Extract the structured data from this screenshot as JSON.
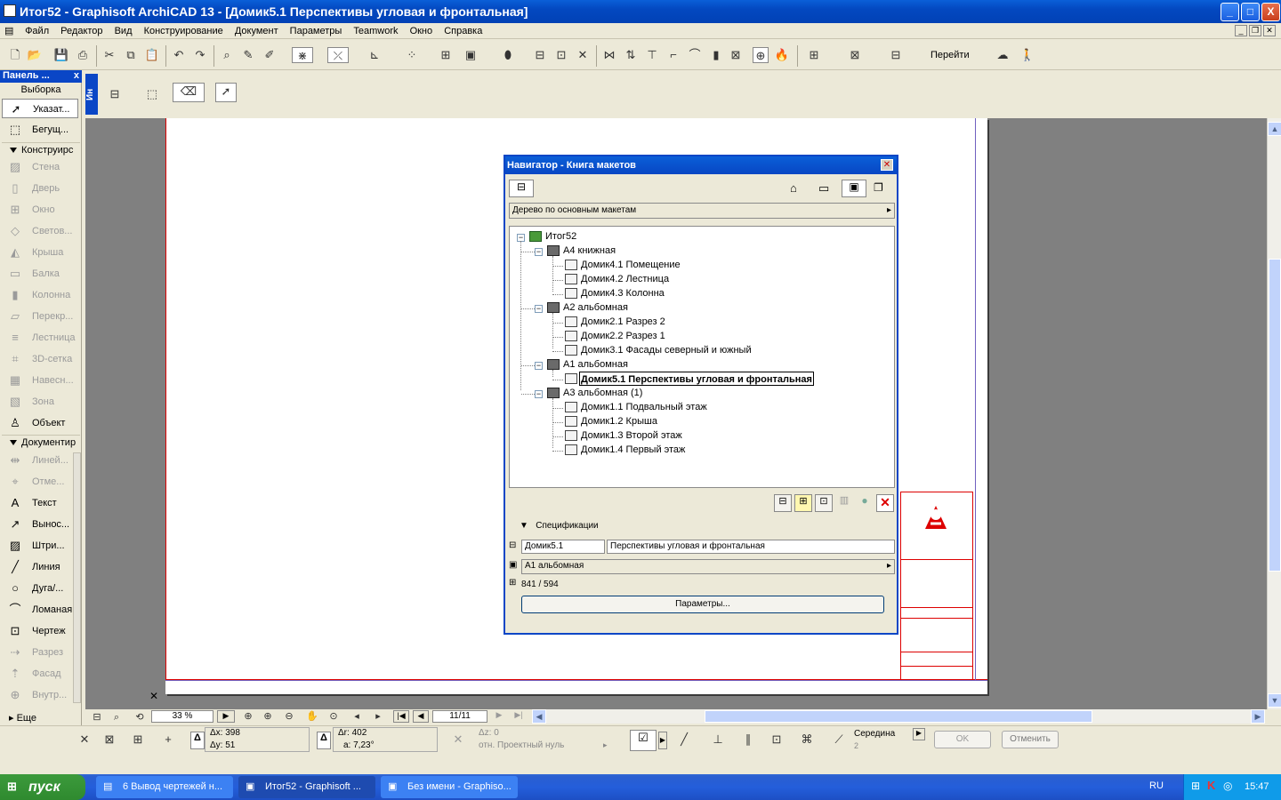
{
  "window": {
    "title": "Итог52 - Graphisoft ArchiCAD 13 - [Домик5.1 Перспективы угловая и фронтальная]",
    "min": "_",
    "max": "□",
    "close": "X"
  },
  "menu": [
    "Файл",
    "Редактор",
    "Вид",
    "Конструирование",
    "Документ",
    "Параметры",
    "Teamwork",
    "Окно",
    "Справка"
  ],
  "toolbar": {
    "goto_label": "Перейти"
  },
  "left_panel": {
    "title": "Панель ...",
    "close": "x",
    "selection_label": "Выборка",
    "items_top": [
      {
        "label": "Указат...",
        "icon": "pointer-icon"
      },
      {
        "label": "Бегущ...",
        "icon": "marquee-icon"
      }
    ],
    "sections": [
      {
        "title": "Конструирс",
        "items": [
          {
            "label": "Стена",
            "dim": true
          },
          {
            "label": "Дверь",
            "dim": true
          },
          {
            "label": "Окно",
            "dim": true
          },
          {
            "label": "Светов...",
            "dim": true
          },
          {
            "label": "Крыша",
            "dim": true
          },
          {
            "label": "Балка",
            "dim": true
          },
          {
            "label": "Колонна",
            "dim": true
          },
          {
            "label": "Перекр...",
            "dim": true
          },
          {
            "label": "Лестница",
            "dim": true
          },
          {
            "label": "3D-сетка",
            "dim": true
          },
          {
            "label": "Навесн...",
            "dim": true
          },
          {
            "label": "Зона",
            "dim": true
          },
          {
            "label": "Объект",
            "dim": false
          }
        ]
      },
      {
        "title": "Документир",
        "items": [
          {
            "label": "Линей...",
            "dim": true
          },
          {
            "label": "Отме...",
            "dim": true
          },
          {
            "label": "Текст",
            "dim": false
          },
          {
            "label": "Вынос...",
            "dim": false
          },
          {
            "label": "Штри...",
            "dim": false
          },
          {
            "label": "Линия",
            "dim": false
          },
          {
            "label": "Дуга/...",
            "dim": false
          },
          {
            "label": "Ломаная",
            "dim": false
          },
          {
            "label": "Чертеж",
            "dim": false
          },
          {
            "label": "Разрез",
            "dim": true
          },
          {
            "label": "Фасад",
            "dim": true
          },
          {
            "label": "Внутр...",
            "dim": true
          }
        ]
      }
    ],
    "more_label": "Еще"
  },
  "info_box": {
    "side_label": "Ин"
  },
  "navigator": {
    "title": "Навигатор - Книга макетов",
    "view_dropdown": "Дерево по основным макетам",
    "tree": {
      "root": "Итог52",
      "books": [
        {
          "name": "А4 книжная",
          "layouts": [
            "Домик4.1 Помещение",
            "Домик4.2 Лестница",
            "Домик4.3 Колонна"
          ]
        },
        {
          "name": "А2 альбомная",
          "layouts": [
            "Домик2.1 Разрез 2",
            "Домик2.2 Разрез 1",
            "Домик3.1 Фасады северный и южный"
          ]
        },
        {
          "name": "А1 альбомная",
          "layouts": [
            "Домик5.1 Перспективы угловая и фронтальная"
          ]
        },
        {
          "name": "А3 альбомная (1)",
          "layouts": [
            "Домик1.1 Подвальный этаж",
            "Домик1.2 Крыша",
            "Домик1.3 Второй этаж",
            "Домик1.4 Первый этаж"
          ]
        }
      ],
      "selected": "Домик5.1 Перспективы угловая и фронтальная"
    },
    "specs_title": "Спецификации",
    "layout_id": "Домик5.1",
    "layout_name": "Перспективы угловая и фронтальная",
    "master_layout": "А1 альбомная",
    "size": "841 / 594",
    "params_button": "Параметры..."
  },
  "bottom_bar": {
    "zoom": "33 %",
    "page": "11/11"
  },
  "coords": {
    "dx_label": "Δx:",
    "dx": "398",
    "dy_label": "Δy:",
    "dy": "51",
    "dr_label": "Δr:",
    "dr": "402",
    "a_label": "a:",
    "a": "7,23°",
    "dz_label": "Δz:",
    "dz": "0",
    "ref_label": "отн. Проектный нуль",
    "snap_label": "Середина",
    "snap_value": "2",
    "ok": "OK",
    "cancel": "Отменить"
  },
  "taskbar": {
    "start": "пуск",
    "tasks": [
      "6 Вывод чертежей н...",
      "Итог52 - Graphisoft ...",
      "Без имени - Graphiso..."
    ],
    "lang": "RU",
    "time": "15:47"
  }
}
